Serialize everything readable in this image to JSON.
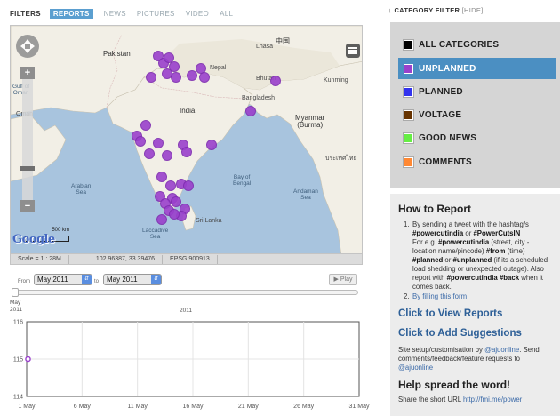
{
  "filters": {
    "label": "FILTERS",
    "tabs": [
      {
        "label": "REPORTS",
        "active": true
      },
      {
        "label": "NEWS",
        "active": false
      },
      {
        "label": "PICTURES",
        "active": false
      },
      {
        "label": "VIDEO",
        "active": false
      },
      {
        "label": "ALL",
        "active": false
      }
    ]
  },
  "map": {
    "labels": {
      "pakistan": "Pakistan",
      "lhasa": "Lhasa",
      "china": "中国",
      "nepal": "Nepal",
      "bhutan": "Bhutan",
      "kunming": "Kunming",
      "gulf_oman": "Gulf of\nOman",
      "oman": "Oman",
      "india": "India",
      "bangladesh": "Bangladesh",
      "myanmar": "Myanmar\n(Burma)",
      "thailand": "ประเทศไทย",
      "arabian_sea": "Arabian\nSea",
      "bay_bengal": "Bay of\nBengal",
      "andaman": "Andaman\nSea",
      "laccadive": "Laccadive\nSea",
      "sri_lanka": "Sri Lanka"
    },
    "scale_text": "500 km",
    "attribution": "Google",
    "status": {
      "scale": "Scale = 1 : 28M",
      "coords": "102.96387, 33.39476",
      "epsg": "EPSG:900913"
    },
    "marker_color": "#9a40cc"
  },
  "date_range": {
    "from_label": "From",
    "to_label": "to",
    "from_value": "May 2011",
    "to_value": "May 2011",
    "play_label": "▶ Play",
    "month_label": "May",
    "year_tick": "2011",
    "year_label": "2011"
  },
  "chart_data": {
    "type": "line",
    "x": [
      "1 May",
      "6 May",
      "11 May",
      "16 May",
      "21 May",
      "26 May",
      "31 May"
    ],
    "x_ticks": [
      "1 May",
      "6 May",
      "11 May",
      "16 May",
      "21 May",
      "26 May",
      "31 May"
    ],
    "y_ticks": [
      "116",
      "115",
      "114"
    ],
    "ylim": [
      114,
      116
    ],
    "series": [
      {
        "points": [
          {
            "x": "1 May",
            "y": 115
          }
        ],
        "color": "#9a40cc"
      }
    ],
    "grid": true
  },
  "category_filter": {
    "title": "CATEGORY FILTER",
    "hide_label": "[HIDE]",
    "items": [
      {
        "label": "ALL CATEGORIES",
        "color": "#000000",
        "active": false
      },
      {
        "label": "UNPLANNED",
        "color": "#9a40cc",
        "active": true
      },
      {
        "label": "PLANNED",
        "color": "#3333ee",
        "active": false
      },
      {
        "label": "VOLTAGE",
        "color": "#663300",
        "active": false
      },
      {
        "label": "GOOD NEWS",
        "color": "#66ee44",
        "active": false
      },
      {
        "label": "COMMENTS",
        "color": "#ff8833",
        "active": false
      }
    ]
  },
  "how_to": {
    "title": "How to Report",
    "step1_a": "By sending a tweet with the hashtag/s",
    "step1_tags": "#powercutindia",
    "step1_or": " or ",
    "step1_tags2": "#PowerCutsIN",
    "step1_b": "For e.g. ",
    "step1_eg": "#powercutindia",
    "step1_c": " (street, city - location name/pincode) ",
    "step1_from": "#from",
    "step1_d": " (time) ",
    "step1_planned": "#planned",
    "step1_e": " or ",
    "step1_unplanned": "#unplanned",
    "step1_f": " (if its a scheduled load shedding or unexpected outage). Also report with ",
    "step1_tag3": "#powercutindia",
    "step1_tag4": "#back",
    "step1_g": " when it comes back.",
    "step2": "By filling this form",
    "view_reports": "Click to View Reports",
    "add_suggestions": "Click to Add Suggestions",
    "credit_a": "Site setup/customisation by ",
    "credit_link1": "@ajuonline",
    "credit_b": ". Send comments/feedback/feature requests to ",
    "credit_link2": "@ajuonline",
    "spread_title": "Help spread the word!",
    "share_text": "Share the short URL ",
    "share_url": "http://fmi.me/power"
  }
}
